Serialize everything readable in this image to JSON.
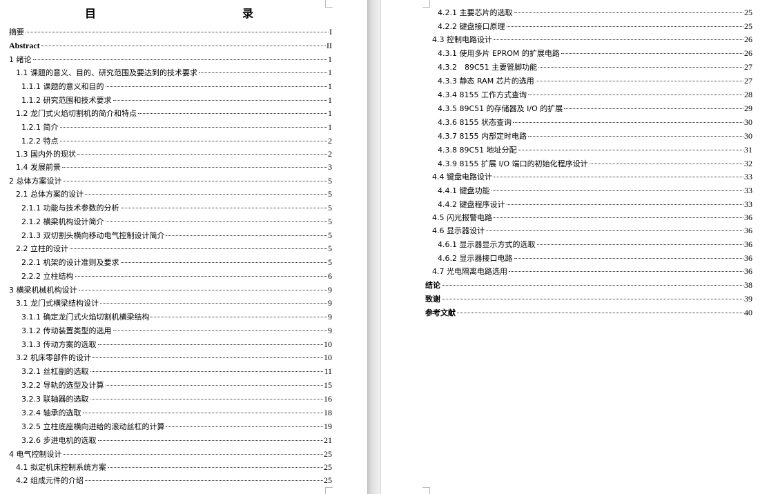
{
  "left_page": {
    "title": "目　　录",
    "entries": [
      {
        "text": "摘要",
        "page": "I",
        "level": 0
      },
      {
        "text": "Abstract",
        "page": "II",
        "level": 0,
        "bold": true,
        "serif": true
      },
      {
        "text": "1 绪论",
        "page": "1",
        "level": 0
      },
      {
        "text": "1.1 课题的意义、目的、研究范围及要达到的技术要求",
        "page": "1",
        "level": 1
      },
      {
        "text": "1.1.1 课题的意义和目的",
        "page": "1",
        "level": 2
      },
      {
        "text": "1.1.2 研究范围和技术要求",
        "page": "1",
        "level": 2
      },
      {
        "text": "1.2 龙门式火焰切割机的简介和特点",
        "page": "1",
        "level": 1
      },
      {
        "text": "1.2.1 简介",
        "page": "1",
        "level": 2
      },
      {
        "text": "1.2.2 特点",
        "page": "2",
        "level": 2
      },
      {
        "text": "1.3 国内外的现状",
        "page": "2",
        "level": 1
      },
      {
        "text": "1.4 发展前景",
        "page": "3",
        "level": 1
      },
      {
        "text": "2 总体方案设计",
        "page": "5",
        "level": 0
      },
      {
        "text": "2.1 总体方案的设计",
        "page": "5",
        "level": 1
      },
      {
        "text": "2.1.1 功能与技术参数的分析",
        "page": "5",
        "level": 2
      },
      {
        "text": "2.1.2 横梁机构设计简介",
        "page": "5",
        "level": 2
      },
      {
        "text": "2.1.3 双切割头横向移动电气控制设计简介",
        "page": "5",
        "level": 2
      },
      {
        "text": "2.2 立柱的设计",
        "page": "5",
        "level": 1
      },
      {
        "text": "2.2.1 机架的设计准则及要求",
        "page": "5",
        "level": 2
      },
      {
        "text": "2.2.2 立柱结构",
        "page": "6",
        "level": 2
      },
      {
        "text": "3 横梁机械机构设计",
        "page": "9",
        "level": 0
      },
      {
        "text": "3.1 龙门式横梁结构设计",
        "page": "9",
        "level": 1
      },
      {
        "text": "3.1.1 确定龙门式火焰切割机横梁结构",
        "page": "9",
        "level": 2
      },
      {
        "text": "3.1.2 传动装置类型的选用",
        "page": "9",
        "level": 2
      },
      {
        "text": "3.1.3 传动方案的选取",
        "page": "10",
        "level": 2
      },
      {
        "text": "3.2 机床零部件的设计",
        "page": "10",
        "level": 1
      },
      {
        "text": "3.2.1 丝杠副的选取",
        "page": "11",
        "level": 2
      },
      {
        "text": "3.2.2 导轨的选型及计算",
        "page": "15",
        "level": 2
      },
      {
        "text": "3.2.3 联轴器的选取",
        "page": "16",
        "level": 2
      },
      {
        "text": "3.2.4 轴承的选取",
        "page": "18",
        "level": 2
      },
      {
        "text": "3.2.5 立柱底座横向进给的滚动丝杠的计算",
        "page": "19",
        "level": 2
      },
      {
        "text": "3.2.6 步进电机的选取",
        "page": "21",
        "level": 2
      },
      {
        "text": "4 电气控制设计",
        "page": "25",
        "level": 0
      },
      {
        "text": "4.1 拟定机床控制系统方案",
        "page": "25",
        "level": 1
      },
      {
        "text": "4.2 组成元件的介绍",
        "page": "25",
        "level": 1
      }
    ]
  },
  "right_page": {
    "entries": [
      {
        "text": "4.2.1 主要芯片的选取",
        "page": "25",
        "level": 2
      },
      {
        "text": "4.2.2 键盘接口原理",
        "page": "25",
        "level": 2
      },
      {
        "text": "4.3 控制电路设计",
        "page": "26",
        "level": 1
      },
      {
        "text": "4.3.1 使用多片 EPROM 的扩展电路",
        "page": "26",
        "level": 2
      },
      {
        "text": "4.3.2　89C51 主要管脚功能",
        "page": "27",
        "level": 2
      },
      {
        "text": "4.3.3 静态 RAM 芯片的选用",
        "page": "27",
        "level": 2
      },
      {
        "text": "4.3.4 8155 工作方式查询",
        "page": "28",
        "level": 2
      },
      {
        "text": "4.3.5 89C51 的存储器及 I/O 的扩展",
        "page": "29",
        "level": 2
      },
      {
        "text": "4.3.6 8155 状态查询",
        "page": "30",
        "level": 2
      },
      {
        "text": "4.3.7 8155 内部定时电路",
        "page": "30",
        "level": 2
      },
      {
        "text": "4.3.8 89C51 地址分配",
        "page": "31",
        "level": 2
      },
      {
        "text": "4.3.9 8155 扩展 I/O 端口的初始化程序设计",
        "page": "32",
        "level": 2
      },
      {
        "text": "4.4 键盘电路设计",
        "page": "33",
        "level": 1
      },
      {
        "text": "4.4.1 键盘功能",
        "page": "33",
        "level": 2
      },
      {
        "text": "4.4.2 键盘程序设计",
        "page": "33",
        "level": 2
      },
      {
        "text": "4.5 闪光报警电路",
        "page": "36",
        "level": 1
      },
      {
        "text": "4.6 显示器设计",
        "page": "36",
        "level": 1
      },
      {
        "text": "4.6.1 显示器显示方式的选取",
        "page": "36",
        "level": 2
      },
      {
        "text": "4.6.2 显示器接口电路",
        "page": "36",
        "level": 2
      },
      {
        "text": "4.7 光电隔离电路选用",
        "page": "36",
        "level": 1
      },
      {
        "text": "结论",
        "page": "38",
        "level": 0,
        "bold": true
      },
      {
        "text": "致谢",
        "page": "39",
        "level": 0,
        "bold": true
      },
      {
        "text": "参考文献",
        "page": "40",
        "level": 0,
        "bold": true
      }
    ]
  },
  "colors": {
    "page_background": "#ffffff",
    "gutter": "#d8d8d8",
    "text": "#000000"
  }
}
